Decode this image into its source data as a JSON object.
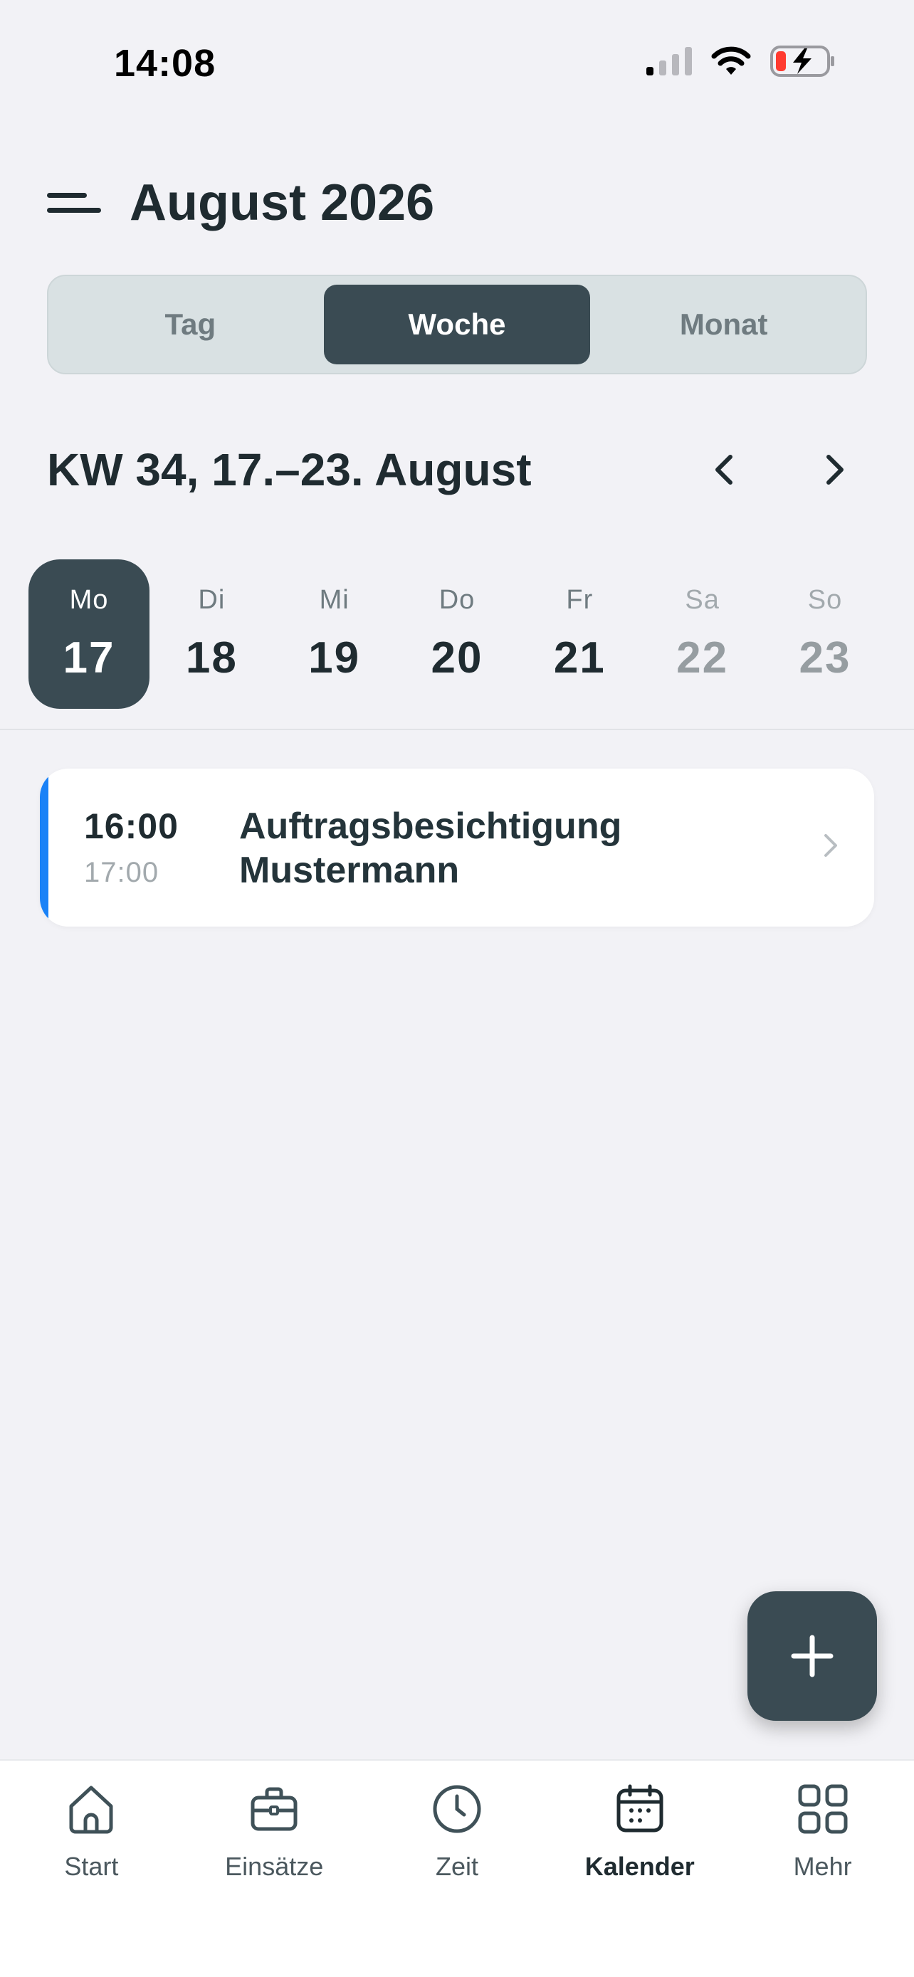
{
  "status_bar": {
    "time": "14:08",
    "icons": [
      "cellular-signal-icon",
      "wifi-icon",
      "battery-charging-icon"
    ]
  },
  "header": {
    "menu_icon": "menu-icon",
    "title": "August 2026"
  },
  "view_switch": {
    "options": [
      {
        "label": "Tag",
        "active": false
      },
      {
        "label": "Woche",
        "active": true
      },
      {
        "label": "Monat",
        "active": false
      }
    ]
  },
  "week": {
    "title": "KW 34, 17.–23. August",
    "prev_icon": "chevron-left-icon",
    "next_icon": "chevron-right-icon"
  },
  "days": [
    {
      "name": "Mo",
      "number": "17",
      "active": true,
      "weekend": false
    },
    {
      "name": "Di",
      "number": "18",
      "active": false,
      "weekend": false
    },
    {
      "name": "Mi",
      "number": "19",
      "active": false,
      "weekend": false
    },
    {
      "name": "Do",
      "number": "20",
      "active": false,
      "weekend": false
    },
    {
      "name": "Fr",
      "number": "21",
      "active": false,
      "weekend": false
    },
    {
      "name": "Sa",
      "number": "22",
      "active": false,
      "weekend": true
    },
    {
      "name": "So",
      "number": "23",
      "active": false,
      "weekend": true
    }
  ],
  "events": [
    {
      "start": "16:00",
      "end": "17:00",
      "title": "Auftragsbesichtigung Mustermann",
      "accent_color": "#1a82f7"
    }
  ],
  "fab": {
    "icon": "plus-icon"
  },
  "tab_bar": {
    "items": [
      {
        "label": "Start",
        "icon": "home-icon",
        "active": false
      },
      {
        "label": "Einsätze",
        "icon": "briefcase-icon",
        "active": false
      },
      {
        "label": "Zeit",
        "icon": "clock-icon",
        "active": false
      },
      {
        "label": "Kalender",
        "icon": "calendar-icon",
        "active": true
      },
      {
        "label": "Mehr",
        "icon": "grid-icon",
        "active": false
      }
    ]
  },
  "colors": {
    "background": "#f2f2f6",
    "primary_dark": "#3a4b53",
    "segment_bg": "#d9e1e3",
    "event_accent": "#1a82f7"
  }
}
